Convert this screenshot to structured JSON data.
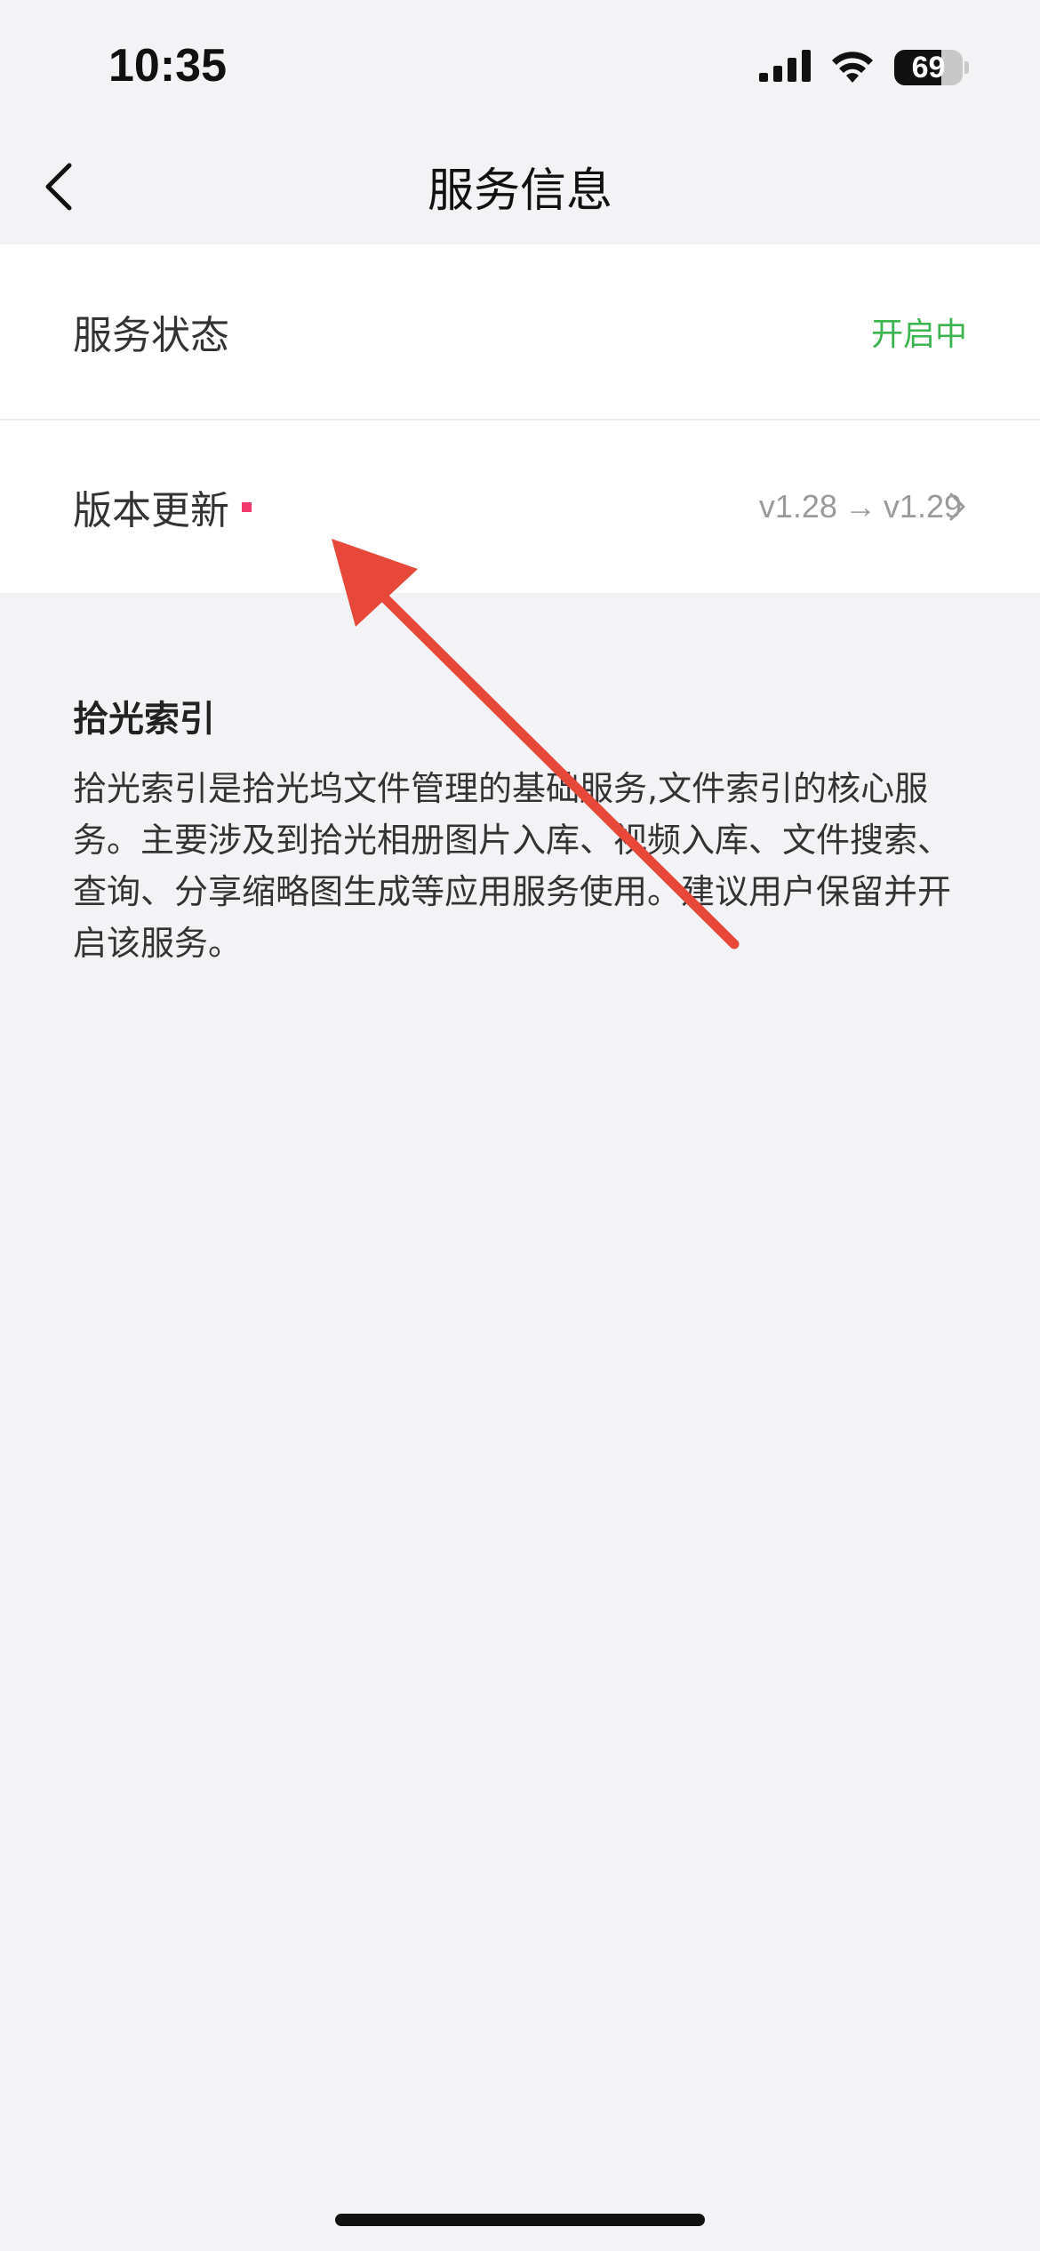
{
  "status_bar": {
    "time": "10:35",
    "battery_percent": "69",
    "battery_level": 0.69
  },
  "nav": {
    "title": "服务信息"
  },
  "settings": {
    "service_status": {
      "label": "服务状态",
      "value": "开启中",
      "value_color": "#3cb550"
    },
    "version_update": {
      "label": "版本更新",
      "from_version": "v1.28",
      "arrow": "→",
      "to_version": "v1.29",
      "dot_color": "#f0386b"
    }
  },
  "description": {
    "title": "拾光索引",
    "body": "拾光索引是拾光坞文件管理的基础服务,文件索引的核心服务。主要涉及到拾光相册图片入库、视频入库、文件搜索、查询、分享缩略图生成等应用服务使用。建议用户保留并开启该服务。"
  },
  "annotation": {
    "color": "#e8483a"
  },
  "colors": {
    "background": "#f3f3f6",
    "card": "#ffffff",
    "accent_green": "#3cb550",
    "badge_red": "#f0386b"
  }
}
